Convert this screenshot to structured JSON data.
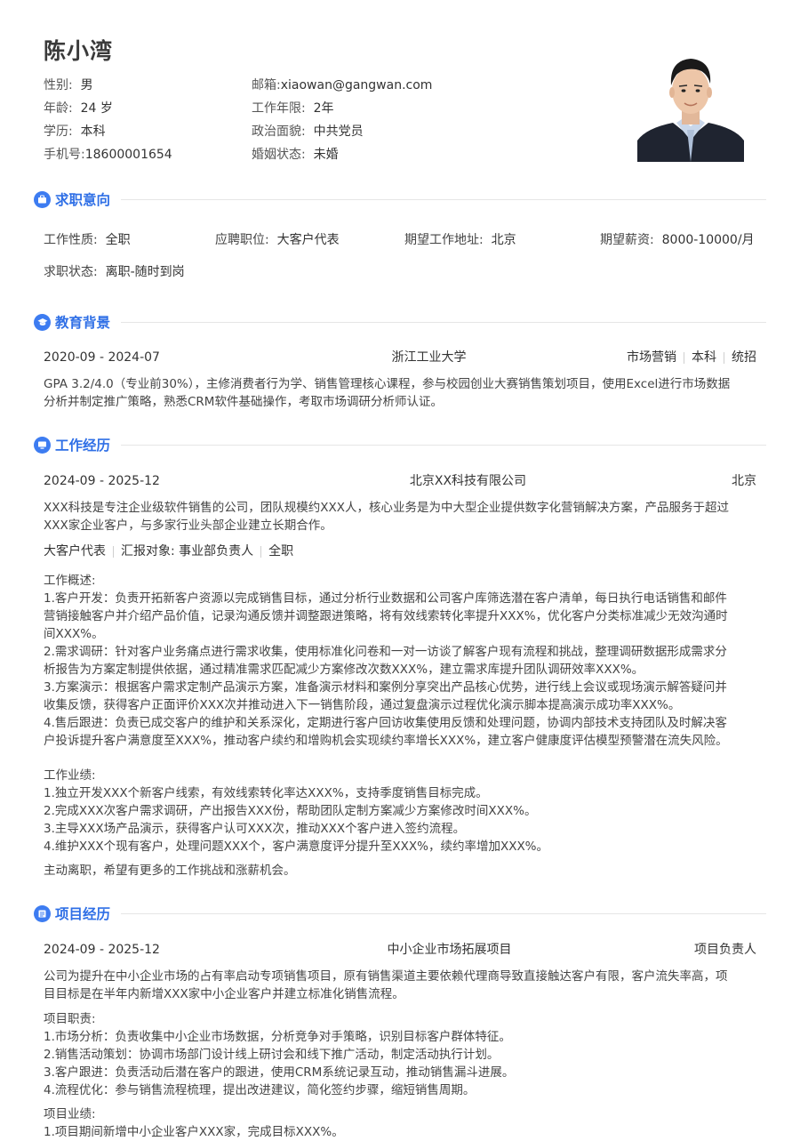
{
  "profile": {
    "name": "陈小湾",
    "gender_label": "性别:",
    "gender": "男",
    "age_label": "年龄:",
    "age": "24 岁",
    "edu_label": "学历:",
    "edu": "本科",
    "phone_label": "手机号:",
    "phone": "18600001654",
    "email_label": "邮箱:",
    "email": "xiaowan@gangwan.com",
    "years_label": "工作年限:",
    "years": "2年",
    "politics_label": "政治面貌:",
    "politics": "中共党员",
    "marital_label": "婚姻状态:",
    "marital": "未婚"
  },
  "intent": {
    "title": "求职意向",
    "type_label": "工作性质:",
    "type": "全职",
    "position_label": "应聘职位:",
    "position": "大客户代表",
    "city_label": "期望工作地址:",
    "city": "北京",
    "salary_label": "期望薪资:",
    "salary": "8000-10000/月",
    "status_label": "求职状态:",
    "status": "离职-随时到岗"
  },
  "education": {
    "title": "教育背景",
    "period": "2020-09 - 2024-07",
    "school": "浙江工业大学",
    "tags": [
      "市场营销",
      "本科",
      "统招"
    ],
    "desc": [
      "GPA 3.2/4.0（专业前30%），主修消费者行为学、销售管理核心课程，参与校园创业大赛销售策划项目，使用Excel进行市场数据",
      "分析并制定推广策略，熟悉CRM软件基础操作，考取市场调研分析师认证。"
    ]
  },
  "work": {
    "title": "工作经历",
    "period": "2024-09 - 2025-12",
    "company": "北京XX科技有限公司",
    "city": "北京",
    "intro": [
      "XXX科技是专注企业级软件销售的公司，团队规模约XXX人，核心业务是为中大型企业提供数字化营销解决方案，产品服务于超过",
      "XXX家企业客户，与多家行业头部企业建立长期合作。"
    ],
    "tags": [
      "大客户代表",
      "汇报对象: 事业部负责人",
      "全职"
    ],
    "overview_lines": [
      "工作概述:",
      "1.客户开发：负责开拓新客户资源以完成销售目标，通过分析行业数据和公司客户库筛选潜在客户清单，每日执行电话销售和邮件",
      "营销接触客户并介绍产品价值，记录沟通反馈并调整跟进策略，将有效线索转化率提升XXX%，优化客户分类标准减少无效沟通时",
      "间XXX%。",
      "2.需求调研：针对客户业务痛点进行需求收集，使用标准化问卷和一对一访谈了解客户现有流程和挑战，整理调研数据形成需求分",
      "析报告为方案定制提供依据，通过精准需求匹配减少方案修改次数XXX%，建立需求库提升团队调研效率XXX%。",
      "3.方案演示：根据客户需求定制产品演示方案，准备演示材料和案例分享突出产品核心优势，进行线上会议或现场演示解答疑问并",
      "收集反馈，获得客户正面评价XXX次并推动进入下一销售阶段，通过复盘演示过程优化演示脚本提高演示成功率XXX%。",
      "4.售后跟进：负责已成交客户的维护和关系深化，定期进行客户回访收集使用反馈和处理问题，协调内部技术支持团队及时解决客",
      "户投诉提升客户满意度至XXX%，推动客户续约和增购机会实现续约率增长XXX%，建立客户健康度评估模型预警潜在流失风险。"
    ],
    "achievement_lines": [
      "工作业绩:",
      "1.独立开发XXX个新客户线索，有效线索转化率达XXX%，支持季度销售目标完成。",
      "2.完成XXX次客户需求调研，产出报告XXX份，帮助团队定制方案减少方案修改时间XXX%。",
      "3.主导XXX场产品演示，获得客户认可XXX次，推动XXX个客户进入签约流程。",
      "4.维护XXX个现有客户，处理问题XXX个，客户满意度评分提升至XXX%，续约率增加XXX%。"
    ],
    "leave_reason": "主动离职，希望有更多的工作挑战和涨薪机会。"
  },
  "project": {
    "title": "项目经历",
    "period": "2024-09 - 2025-12",
    "name": "中小企业市场拓展项目",
    "role": "项目负责人",
    "intro": [
      "公司为提升在中小企业市场的占有率启动专项销售项目，原有销售渠道主要依赖代理商导致直接触达客户有限，客户流失率高，项",
      "目目标是在半年内新增XXX家中小企业客户并建立标准化销售流程。"
    ],
    "duty_lines": [
      "项目职责:",
      "1.市场分析：负责收集中小企业市场数据，分析竞争对手策略，识别目标客户群体特征。",
      "2.销售活动策划：协调市场部门设计线上研讨会和线下推广活动，制定活动执行计划。",
      "3.客户跟进：负责活动后潜在客户的跟进，使用CRM系统记录互动，推动销售漏斗进展。",
      "4.流程优化：参与销售流程梳理，提出改进建议，简化签约步骤，缩短销售周期。"
    ],
    "result_lines": [
      "项目业绩:",
      "1.项目期间新增中小企业客户XXX家，完成目标XXX%。"
    ]
  }
}
